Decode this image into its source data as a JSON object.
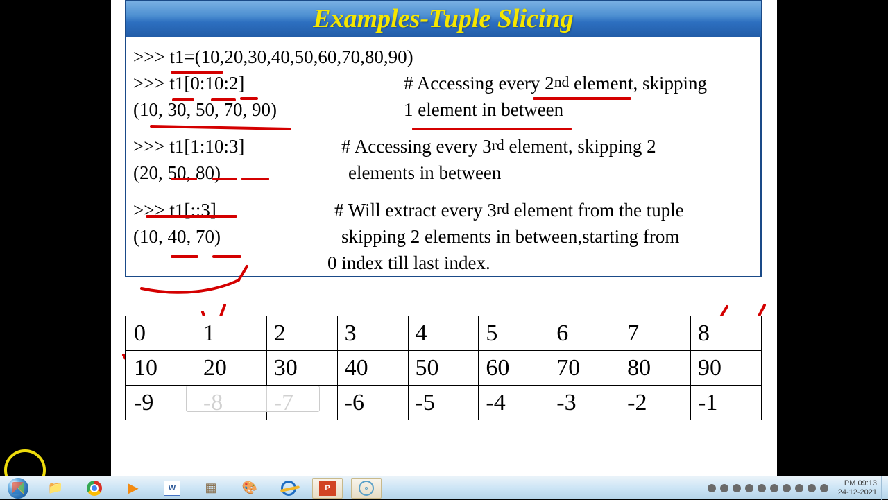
{
  "title": "Examples-Tuple Slicing",
  "code": {
    "l1": ">>> t1=(10,20,30,40,50,60,70,80,90)",
    "l2_left": ">>> t1[0:10:2]",
    "l2_right_a": "# Accessing every 2",
    "l2_right_b": " element, skipping",
    "l3_left": "(10, 30, 50, 70, 90)",
    "l3_right": "1 element in between",
    "l4_left": ">>> t1[1:10:3]",
    "l4_right_a": "# Accessing every 3",
    "l4_right_b": "  element, skipping  2",
    "l5_left": "(20, 50, 80)",
    "l5_right": "elements in between",
    "l6_left": ">>> t1[::3]",
    "l6_right_a": "# Will extract every 3",
    "l6_right_b": " element from the tuple",
    "l7_left": "(10, 40, 70)",
    "l7_right": "skipping 2 elements in between,starting from",
    "l8_right": "0 index till last index."
  },
  "table": {
    "pos": [
      "0",
      "1",
      "2",
      "3",
      "4",
      "5",
      "6",
      "7",
      "8"
    ],
    "vals": [
      "10",
      "20",
      "30",
      "40",
      "50",
      "60",
      "70",
      "80",
      "90"
    ],
    "neg": [
      "-9",
      "-8",
      "-7",
      "-6",
      "-5",
      "-4",
      "-3",
      "-2",
      "-1"
    ]
  },
  "tooltip": "",
  "taskbar": {
    "apps": [
      "start",
      "explorer",
      "chrome",
      "wmp",
      "word",
      "bricks",
      "paint",
      "ie",
      "powerpoint",
      "disc"
    ],
    "clock_time": "PM 09:13",
    "clock_date": "24-12-2021"
  }
}
